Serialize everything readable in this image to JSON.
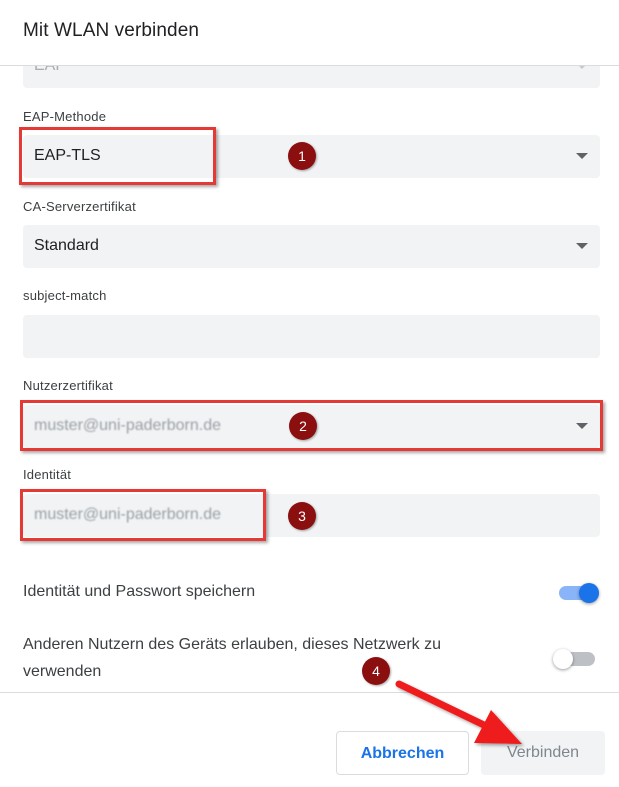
{
  "dialog": {
    "title": "Mit WLAN verbinden"
  },
  "fields": {
    "security": {
      "value": "EAP"
    },
    "eap_method": {
      "label": "EAP-Methode",
      "value": "EAP-TLS"
    },
    "ca_cert": {
      "label": "CA-Serverzertifikat",
      "value": "Standard"
    },
    "subject_match": {
      "label": "subject-match",
      "value": ""
    },
    "user_cert": {
      "label": "Nutzerzertifikat",
      "value": "muster@uni-paderborn.de"
    },
    "identity": {
      "label": "Identität",
      "value": "muster@uni-paderborn.de"
    }
  },
  "toggles": {
    "save_identity": {
      "label": "Identität und Passwort speichern",
      "on": true
    },
    "allow_others": {
      "label": "Anderen Nutzern des Geräts erlauben, dieses Netzwerk zu verwenden",
      "on": false
    }
  },
  "annotations": {
    "step1": "1",
    "step2": "2",
    "step3": "3",
    "step4": "4"
  },
  "buttons": {
    "cancel": "Abbrechen",
    "connect": "Verbinden"
  },
  "colors": {
    "accent": "#1a73e8",
    "highlight": "#e53935",
    "badge": "#8b0f0f"
  }
}
